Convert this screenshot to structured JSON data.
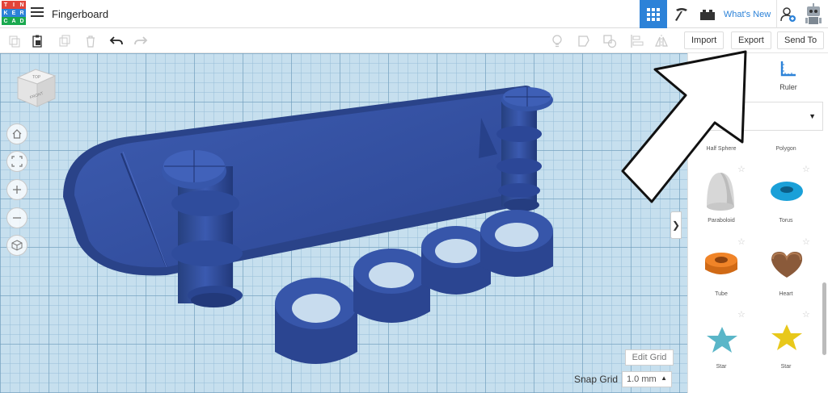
{
  "app": {
    "logo_letters": [
      "T",
      "I",
      "N",
      "K",
      "E",
      "R",
      "C",
      "A",
      "D"
    ],
    "logo_colors": [
      "#e2443a",
      "#e2443a",
      "#e2443a",
      "#2c82d8",
      "#2c82d8",
      "#2c82d8",
      "#1aa94f",
      "#1aa94f",
      "#1aa94f"
    ],
    "title": "Fingerboard"
  },
  "topbar": {
    "whats_new": "What's New"
  },
  "toolbar": {
    "import": "Import",
    "export": "Export",
    "send_to": "Send To"
  },
  "panel": {
    "ruler": "Ruler",
    "shapes": [
      {
        "label": "Half Sphere"
      },
      {
        "label": "Polygon"
      },
      {
        "label": "Paraboloid"
      },
      {
        "label": "Torus"
      },
      {
        "label": "Tube"
      },
      {
        "label": "Heart"
      },
      {
        "label": "Star"
      },
      {
        "label": "Star"
      }
    ]
  },
  "workplane": {
    "edit_grid": "Edit Grid",
    "snap_grid_label": "Snap Grid",
    "snap_grid_value": "1.0 mm",
    "view_cube_top": "TOP",
    "view_cube_front": "FRONT"
  },
  "colors": {
    "accent": "#2c82d8",
    "model_blue": "#2f4a9a",
    "workplane": "#c6dfee"
  }
}
